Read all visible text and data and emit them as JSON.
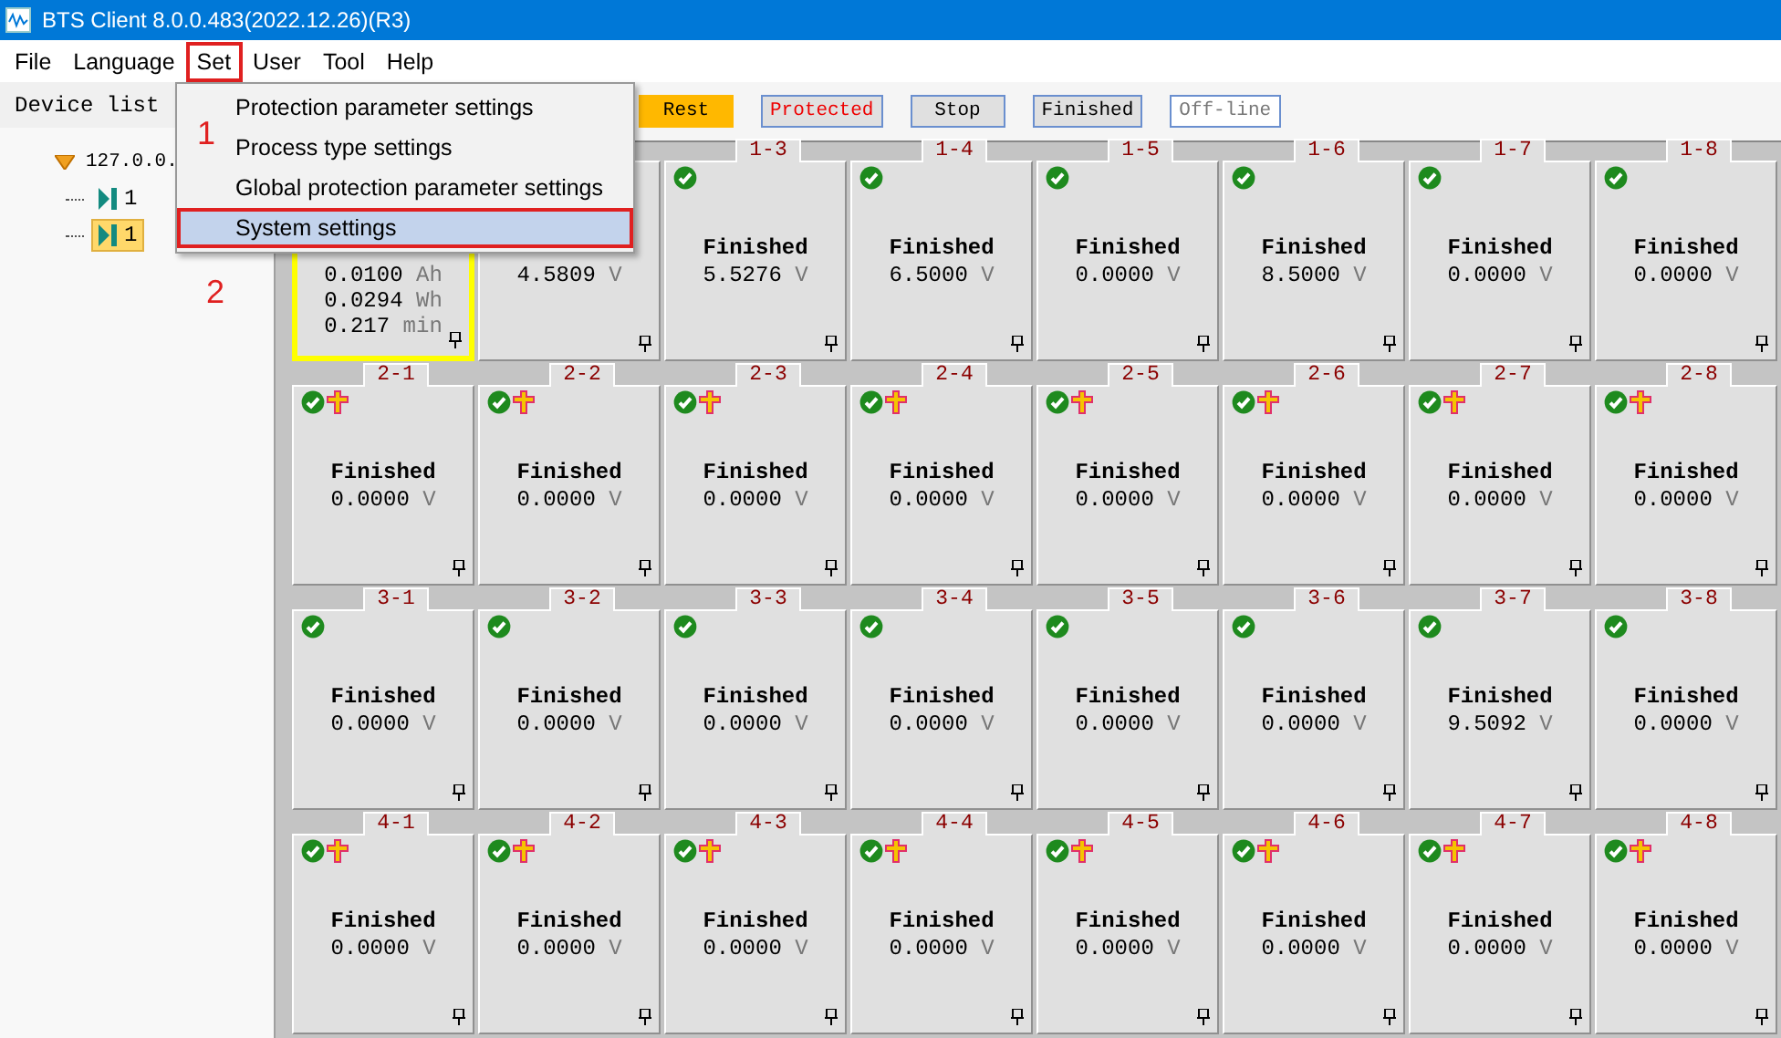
{
  "window": {
    "title": "BTS Client 8.0.0.483(2022.12.26)(R3)"
  },
  "menu_bar": [
    {
      "label": "File",
      "selected": false
    },
    {
      "label": "Language",
      "selected": false
    },
    {
      "label": "Set",
      "selected": true
    },
    {
      "label": "User",
      "selected": false
    },
    {
      "label": "Tool",
      "selected": false
    },
    {
      "label": "Help",
      "selected": false
    }
  ],
  "dropdown": [
    {
      "label": "Protection parameter settings",
      "selected": false
    },
    {
      "label": "Process type settings",
      "selected": false
    },
    {
      "label": "Global protection parameter settings",
      "selected": false
    },
    {
      "label": "System settings",
      "selected": true
    }
  ],
  "annotations": [
    "1",
    "2"
  ],
  "device_list": {
    "title": "Device list",
    "tree": [
      {
        "label": "127.0.0.",
        "expanded": true,
        "children": [
          {
            "label": "1",
            "selected": false
          },
          {
            "label": "1",
            "selected": true
          }
        ]
      }
    ]
  },
  "legend": [
    {
      "label": "Rest",
      "kind": "rest"
    },
    {
      "label": "Protected",
      "kind": "protected"
    },
    {
      "label": "Stop",
      "kind": "stop"
    },
    {
      "label": "Finished",
      "kind": "finished"
    },
    {
      "label": "Off-line",
      "kind": "offline"
    }
  ],
  "channels": [
    {
      "selected": true,
      "lines": [
        {
          "value": "0.0100",
          "unit": "Ah"
        },
        {
          "value": "0.0294",
          "unit": "Wh"
        },
        {
          "value": "0.217",
          "unit": "min"
        }
      ]
    },
    {
      "selected": false,
      "lines": [
        {
          "value": "4.5809",
          "unit": "V"
        }
      ]
    },
    {
      "label": "1-3",
      "selected": false,
      "done": true,
      "protected": false,
      "status": "Finished",
      "lines": [
        {
          "value": "5.5276",
          "unit": "V"
        }
      ]
    },
    {
      "label": "1-4",
      "selected": false,
      "done": true,
      "protected": false,
      "status": "Finished",
      "lines": [
        {
          "value": "6.5000",
          "unit": "V"
        }
      ]
    },
    {
      "label": "1-5",
      "selected": false,
      "done": true,
      "protected": false,
      "status": "Finished",
      "lines": [
        {
          "value": "0.0000",
          "unit": "V"
        }
      ]
    },
    {
      "label": "1-6",
      "selected": false,
      "done": true,
      "protected": false,
      "status": "Finished",
      "lines": [
        {
          "value": "8.5000",
          "unit": "V"
        }
      ]
    },
    {
      "label": "1-7",
      "selected": false,
      "done": true,
      "protected": false,
      "status": "Finished",
      "lines": [
        {
          "value": "0.0000",
          "unit": "V"
        }
      ]
    },
    {
      "label": "1-8",
      "selected": false,
      "done": true,
      "protected": false,
      "status": "Finished",
      "lines": [
        {
          "value": "0.0000",
          "unit": "V"
        }
      ]
    },
    {
      "label": "2-1",
      "selected": false,
      "done": true,
      "protected": true,
      "status": "Finished",
      "lines": [
        {
          "value": "0.0000",
          "unit": "V"
        }
      ]
    },
    {
      "label": "2-2",
      "selected": false,
      "done": true,
      "protected": true,
      "status": "Finished",
      "lines": [
        {
          "value": "0.0000",
          "unit": "V"
        }
      ]
    },
    {
      "label": "2-3",
      "selected": false,
      "done": true,
      "protected": true,
      "status": "Finished",
      "lines": [
        {
          "value": "0.0000",
          "unit": "V"
        }
      ]
    },
    {
      "label": "2-4",
      "selected": false,
      "done": true,
      "protected": true,
      "status": "Finished",
      "lines": [
        {
          "value": "0.0000",
          "unit": "V"
        }
      ]
    },
    {
      "label": "2-5",
      "selected": false,
      "done": true,
      "protected": true,
      "status": "Finished",
      "lines": [
        {
          "value": "0.0000",
          "unit": "V"
        }
      ]
    },
    {
      "label": "2-6",
      "selected": false,
      "done": true,
      "protected": true,
      "status": "Finished",
      "lines": [
        {
          "value": "0.0000",
          "unit": "V"
        }
      ]
    },
    {
      "label": "2-7",
      "selected": false,
      "done": true,
      "protected": true,
      "status": "Finished",
      "lines": [
        {
          "value": "0.0000",
          "unit": "V"
        }
      ]
    },
    {
      "label": "2-8",
      "selected": false,
      "done": true,
      "protected": true,
      "status": "Finished",
      "lines": [
        {
          "value": "0.0000",
          "unit": "V"
        }
      ]
    },
    {
      "label": "3-1",
      "selected": false,
      "done": true,
      "protected": false,
      "status": "Finished",
      "lines": [
        {
          "value": "0.0000",
          "unit": "V"
        }
      ]
    },
    {
      "label": "3-2",
      "selected": false,
      "done": true,
      "protected": false,
      "status": "Finished",
      "lines": [
        {
          "value": "0.0000",
          "unit": "V"
        }
      ]
    },
    {
      "label": "3-3",
      "selected": false,
      "done": true,
      "protected": false,
      "status": "Finished",
      "lines": [
        {
          "value": "0.0000",
          "unit": "V"
        }
      ]
    },
    {
      "label": "3-4",
      "selected": false,
      "done": true,
      "protected": false,
      "status": "Finished",
      "lines": [
        {
          "value": "0.0000",
          "unit": "V"
        }
      ]
    },
    {
      "label": "3-5",
      "selected": false,
      "done": true,
      "protected": false,
      "status": "Finished",
      "lines": [
        {
          "value": "0.0000",
          "unit": "V"
        }
      ]
    },
    {
      "label": "3-6",
      "selected": false,
      "done": true,
      "protected": false,
      "status": "Finished",
      "lines": [
        {
          "value": "0.0000",
          "unit": "V"
        }
      ]
    },
    {
      "label": "3-7",
      "selected": false,
      "done": true,
      "protected": false,
      "status": "Finished",
      "lines": [
        {
          "value": "9.5092",
          "unit": "V"
        }
      ]
    },
    {
      "label": "3-8",
      "selected": false,
      "done": true,
      "protected": false,
      "status": "Finished",
      "lines": [
        {
          "value": "0.0000",
          "unit": "V"
        }
      ]
    },
    {
      "label": "4-1",
      "selected": false,
      "done": true,
      "protected": true,
      "status": "Finished",
      "lines": [
        {
          "value": "0.0000",
          "unit": "V"
        }
      ]
    },
    {
      "label": "4-2",
      "selected": false,
      "done": true,
      "protected": true,
      "status": "Finished",
      "lines": [
        {
          "value": "0.0000",
          "unit": "V"
        }
      ]
    },
    {
      "label": "4-3",
      "selected": false,
      "done": true,
      "protected": true,
      "status": "Finished",
      "lines": [
        {
          "value": "0.0000",
          "unit": "V"
        }
      ]
    },
    {
      "label": "4-4",
      "selected": false,
      "done": true,
      "protected": true,
      "status": "Finished",
      "lines": [
        {
          "value": "0.0000",
          "unit": "V"
        }
      ]
    },
    {
      "label": "4-5",
      "selected": false,
      "done": true,
      "protected": true,
      "status": "Finished",
      "lines": [
        {
          "value": "0.0000",
          "unit": "V"
        }
      ]
    },
    {
      "label": "4-6",
      "selected": false,
      "done": true,
      "protected": true,
      "status": "Finished",
      "lines": [
        {
          "value": "0.0000",
          "unit": "V"
        }
      ]
    },
    {
      "label": "4-7",
      "selected": false,
      "done": true,
      "protected": true,
      "status": "Finished",
      "lines": [
        {
          "value": "0.0000",
          "unit": "V"
        }
      ]
    },
    {
      "label": "4-8",
      "selected": false,
      "done": true,
      "protected": true,
      "status": "Finished",
      "lines": [
        {
          "value": "0.0000",
          "unit": "V"
        }
      ]
    }
  ]
}
